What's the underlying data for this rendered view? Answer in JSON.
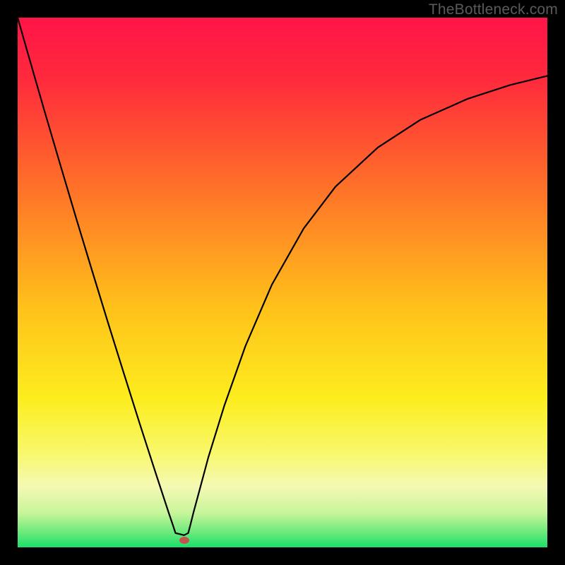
{
  "watermark": "TheBottleneck.com",
  "marker": {
    "color": "#c0544e",
    "x_pct": 31.4,
    "y_pct": 98.6
  },
  "gradient_stops": [
    {
      "offset": 0,
      "color": "#ff1448"
    },
    {
      "offset": 0.12,
      "color": "#ff2b3c"
    },
    {
      "offset": 0.3,
      "color": "#ff6a2a"
    },
    {
      "offset": 0.55,
      "color": "#ffc21a"
    },
    {
      "offset": 0.72,
      "color": "#fded1e"
    },
    {
      "offset": 0.82,
      "color": "#f8f86a"
    },
    {
      "offset": 0.885,
      "color": "#f4f9b4"
    },
    {
      "offset": 0.935,
      "color": "#c8f59a"
    },
    {
      "offset": 0.975,
      "color": "#63e879"
    },
    {
      "offset": 1.0,
      "color": "#19e06a"
    }
  ],
  "chart_data": {
    "type": "line",
    "title": "",
    "xlabel": "",
    "ylabel": "",
    "xlim": [
      0,
      100
    ],
    "ylim": [
      0,
      100
    ],
    "series": [
      {
        "name": "curve",
        "x": [
          0,
          2,
          5,
          8,
          11,
          14,
          17,
          20,
          23,
          26,
          28.5,
          29.3,
          29.8,
          31.4,
          32.2,
          32.6,
          33.2,
          34.2,
          36,
          39,
          43,
          48,
          54,
          60,
          68,
          76,
          85,
          93,
          100
        ],
        "y": [
          100,
          93,
          82.6,
          72.4,
          62.3,
          52.4,
          42.6,
          33.0,
          23.5,
          14.2,
          6.6,
          4.2,
          2.7,
          2.3,
          2.7,
          4.2,
          6.6,
          10.3,
          17.0,
          26.7,
          38.0,
          49.6,
          60.2,
          68.1,
          75.5,
          80.7,
          84.7,
          87.3,
          89.0
        ],
        "note": "y is percentage of plot height from bottom; x is percentage from left"
      }
    ],
    "marker_point": {
      "x": 31.4,
      "y": 1.4
    },
    "background": "vertical gradient red→orange→yellow→green (bottleneck heatmap)"
  }
}
